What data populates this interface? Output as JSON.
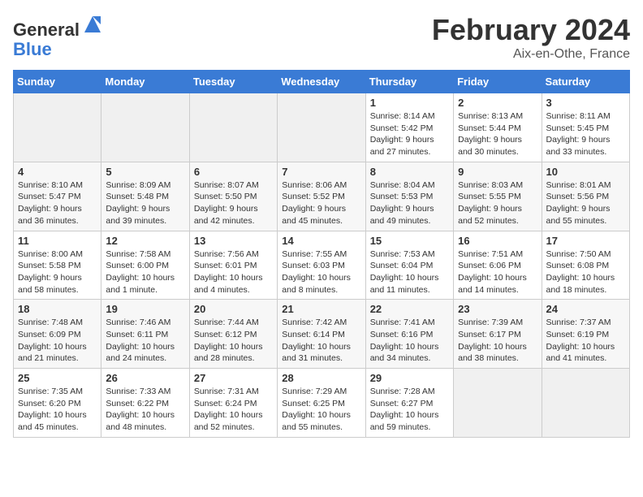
{
  "header": {
    "logo_line1": "General",
    "logo_line2": "Blue",
    "title": "February 2024",
    "subtitle": "Aix-en-Othe, France"
  },
  "weekdays": [
    "Sunday",
    "Monday",
    "Tuesday",
    "Wednesday",
    "Thursday",
    "Friday",
    "Saturday"
  ],
  "weeks": [
    [
      {
        "day": "",
        "info": ""
      },
      {
        "day": "",
        "info": ""
      },
      {
        "day": "",
        "info": ""
      },
      {
        "day": "",
        "info": ""
      },
      {
        "day": "1",
        "info": "Sunrise: 8:14 AM\nSunset: 5:42 PM\nDaylight: 9 hours\nand 27 minutes."
      },
      {
        "day": "2",
        "info": "Sunrise: 8:13 AM\nSunset: 5:44 PM\nDaylight: 9 hours\nand 30 minutes."
      },
      {
        "day": "3",
        "info": "Sunrise: 8:11 AM\nSunset: 5:45 PM\nDaylight: 9 hours\nand 33 minutes."
      }
    ],
    [
      {
        "day": "4",
        "info": "Sunrise: 8:10 AM\nSunset: 5:47 PM\nDaylight: 9 hours\nand 36 minutes."
      },
      {
        "day": "5",
        "info": "Sunrise: 8:09 AM\nSunset: 5:48 PM\nDaylight: 9 hours\nand 39 minutes."
      },
      {
        "day": "6",
        "info": "Sunrise: 8:07 AM\nSunset: 5:50 PM\nDaylight: 9 hours\nand 42 minutes."
      },
      {
        "day": "7",
        "info": "Sunrise: 8:06 AM\nSunset: 5:52 PM\nDaylight: 9 hours\nand 45 minutes."
      },
      {
        "day": "8",
        "info": "Sunrise: 8:04 AM\nSunset: 5:53 PM\nDaylight: 9 hours\nand 49 minutes."
      },
      {
        "day": "9",
        "info": "Sunrise: 8:03 AM\nSunset: 5:55 PM\nDaylight: 9 hours\nand 52 minutes."
      },
      {
        "day": "10",
        "info": "Sunrise: 8:01 AM\nSunset: 5:56 PM\nDaylight: 9 hours\nand 55 minutes."
      }
    ],
    [
      {
        "day": "11",
        "info": "Sunrise: 8:00 AM\nSunset: 5:58 PM\nDaylight: 9 hours\nand 58 minutes."
      },
      {
        "day": "12",
        "info": "Sunrise: 7:58 AM\nSunset: 6:00 PM\nDaylight: 10 hours\nand 1 minute."
      },
      {
        "day": "13",
        "info": "Sunrise: 7:56 AM\nSunset: 6:01 PM\nDaylight: 10 hours\nand 4 minutes."
      },
      {
        "day": "14",
        "info": "Sunrise: 7:55 AM\nSunset: 6:03 PM\nDaylight: 10 hours\nand 8 minutes."
      },
      {
        "day": "15",
        "info": "Sunrise: 7:53 AM\nSunset: 6:04 PM\nDaylight: 10 hours\nand 11 minutes."
      },
      {
        "day": "16",
        "info": "Sunrise: 7:51 AM\nSunset: 6:06 PM\nDaylight: 10 hours\nand 14 minutes."
      },
      {
        "day": "17",
        "info": "Sunrise: 7:50 AM\nSunset: 6:08 PM\nDaylight: 10 hours\nand 18 minutes."
      }
    ],
    [
      {
        "day": "18",
        "info": "Sunrise: 7:48 AM\nSunset: 6:09 PM\nDaylight: 10 hours\nand 21 minutes."
      },
      {
        "day": "19",
        "info": "Sunrise: 7:46 AM\nSunset: 6:11 PM\nDaylight: 10 hours\nand 24 minutes."
      },
      {
        "day": "20",
        "info": "Sunrise: 7:44 AM\nSunset: 6:12 PM\nDaylight: 10 hours\nand 28 minutes."
      },
      {
        "day": "21",
        "info": "Sunrise: 7:42 AM\nSunset: 6:14 PM\nDaylight: 10 hours\nand 31 minutes."
      },
      {
        "day": "22",
        "info": "Sunrise: 7:41 AM\nSunset: 6:16 PM\nDaylight: 10 hours\nand 34 minutes."
      },
      {
        "day": "23",
        "info": "Sunrise: 7:39 AM\nSunset: 6:17 PM\nDaylight: 10 hours\nand 38 minutes."
      },
      {
        "day": "24",
        "info": "Sunrise: 7:37 AM\nSunset: 6:19 PM\nDaylight: 10 hours\nand 41 minutes."
      }
    ],
    [
      {
        "day": "25",
        "info": "Sunrise: 7:35 AM\nSunset: 6:20 PM\nDaylight: 10 hours\nand 45 minutes."
      },
      {
        "day": "26",
        "info": "Sunrise: 7:33 AM\nSunset: 6:22 PM\nDaylight: 10 hours\nand 48 minutes."
      },
      {
        "day": "27",
        "info": "Sunrise: 7:31 AM\nSunset: 6:24 PM\nDaylight: 10 hours\nand 52 minutes."
      },
      {
        "day": "28",
        "info": "Sunrise: 7:29 AM\nSunset: 6:25 PM\nDaylight: 10 hours\nand 55 minutes."
      },
      {
        "day": "29",
        "info": "Sunrise: 7:28 AM\nSunset: 6:27 PM\nDaylight: 10 hours\nand 59 minutes."
      },
      {
        "day": "",
        "info": ""
      },
      {
        "day": "",
        "info": ""
      }
    ]
  ]
}
